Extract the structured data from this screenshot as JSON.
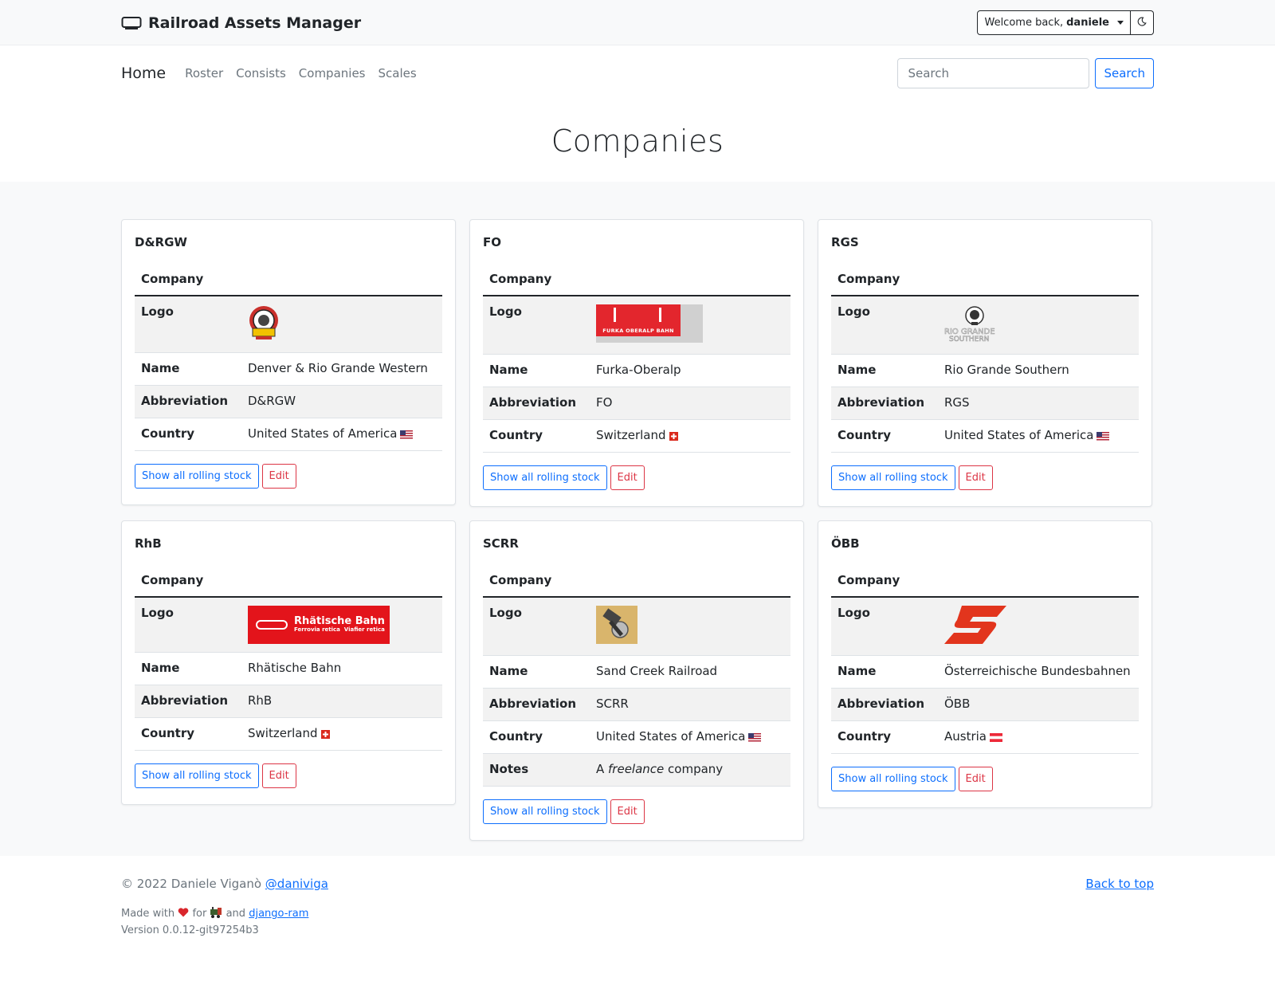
{
  "app": {
    "title": "Railroad Assets Manager",
    "welcome_prefix": "Welcome back, ",
    "username": "daniele"
  },
  "nav": {
    "home": "Home",
    "links": [
      "Roster",
      "Consists",
      "Companies",
      "Scales"
    ],
    "search_placeholder": "Search",
    "search_button": "Search"
  },
  "page": {
    "title": "Companies"
  },
  "labels": {
    "caption": "Company",
    "logo": "Logo",
    "name": "Name",
    "abbreviation": "Abbreviation",
    "country": "Country",
    "notes": "Notes",
    "show_button": "Show all rolling stock",
    "edit_button": "Edit"
  },
  "companies": [
    {
      "title": "D&RGW",
      "name": "Denver & Rio Grande Western",
      "abbreviation": "D&RGW",
      "country": "United States of America",
      "flag": "us-flag-icon",
      "logo": "drgw-logo"
    },
    {
      "title": "FO",
      "name": "Furka-Oberalp",
      "abbreviation": "FO",
      "country": "Switzerland",
      "flag": "ch-flag-icon",
      "logo": "fo-logo",
      "logo_text": "FURKA OBERALP BAHN"
    },
    {
      "title": "RGS",
      "name": "Rio Grande Southern",
      "abbreviation": "RGS",
      "country": "United States of America",
      "flag": "us-flag-icon",
      "logo": "rgs-logo"
    },
    {
      "title": "RhB",
      "name": "Rhätische Bahn",
      "abbreviation": "RhB",
      "country": "Switzerland",
      "flag": "ch-flag-icon",
      "logo": "rhb-logo",
      "logo_text": "Rhätische Bahn",
      "logo_sub": "Ferrovia retica  Viafier retica"
    },
    {
      "title": "SCRR",
      "name": "Sand Creek Railroad",
      "abbreviation": "SCRR",
      "country": "United States of America",
      "flag": "us-flag-icon",
      "logo": "scrr-logo",
      "notes_prefix": "A ",
      "notes_em": "freelance",
      "notes_suffix": " company"
    },
    {
      "title": "ÖBB",
      "name": "Österreichische Bundesbahnen",
      "abbreviation": "ÖBB",
      "country": "Austria",
      "flag": "at-flag-icon",
      "logo": "obb-logo"
    }
  ],
  "footer": {
    "copyright": "© 2022 Daniele Viganò ",
    "handle": "@daniviga",
    "back_to_top": "Back to top",
    "made_with": "Made with",
    "for": "for",
    "and": "and",
    "project": "django-ram",
    "version": "Version 0.0.12-git97254b3"
  }
}
